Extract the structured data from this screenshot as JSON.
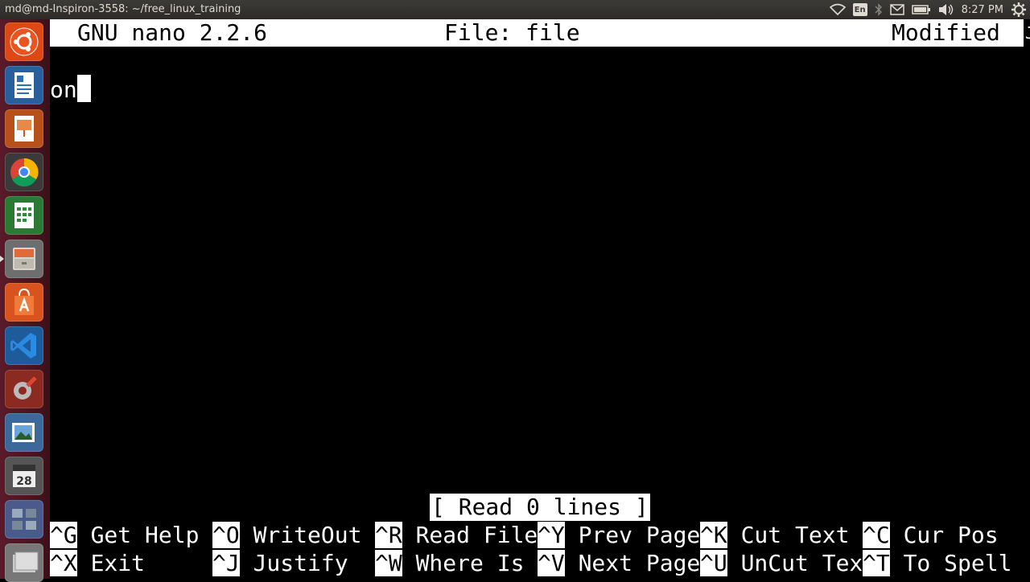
{
  "top_panel": {
    "window_title": "md@md-Inspiron-3558: ~/free_linux_training",
    "keyboard_layout": "En",
    "clock": "8:27 PM",
    "indicator_icons": [
      "wifi-icon",
      "keyboard-layout-icon",
      "bluetooth-icon",
      "mail-icon",
      "battery-icon",
      "volume-icon",
      "settings-gear-icon"
    ]
  },
  "launcher": {
    "items": [
      {
        "name": "dash-home",
        "icon": "ubuntu-logo-icon",
        "color": "#dd4814"
      },
      {
        "name": "libreoffice-writer",
        "icon": "writer-doc-icon",
        "color": "#2a6fb8"
      },
      {
        "name": "libreoffice-impress",
        "icon": "impress-presentation-icon",
        "color": "#c85a19"
      },
      {
        "name": "chrome",
        "icon": "chrome-icon",
        "color": "#4285f4"
      },
      {
        "name": "libreoffice-calc",
        "icon": "calc-spreadsheet-icon",
        "color": "#2e8b3a"
      },
      {
        "name": "files",
        "icon": "file-cabinet-icon",
        "color": "#8a8a8a"
      },
      {
        "name": "software-center",
        "icon": "shopping-bag-icon",
        "color": "#e2571e"
      },
      {
        "name": "vscode",
        "icon": "vscode-icon",
        "color": "#0078d4"
      },
      {
        "name": "system-settings",
        "icon": "settings-wrench-icon",
        "color": "#b23a2a"
      },
      {
        "name": "image-viewer",
        "icon": "photo-icon",
        "color": "#4a7fb5"
      },
      {
        "name": "calendar",
        "icon": "calendar-icon",
        "color": "#6a6a6a",
        "text": "28"
      },
      {
        "name": "workspaces",
        "icon": "workspace-switcher-icon",
        "color": "#5a6a9a"
      }
    ]
  },
  "nano": {
    "version": "GNU nano 2.2.6",
    "file_label": "File: file",
    "modified": "Modified",
    "header_edge": "J",
    "buffer_text": "on",
    "status_message": "[ Read 0 lines ]",
    "shortcuts_row1": [
      {
        "key": "^G",
        "label": " Get Help"
      },
      {
        "key": "^O",
        "label": " WriteOut"
      },
      {
        "key": "^R",
        "label": " Read File"
      },
      {
        "key": "^Y",
        "label": " Prev Page"
      },
      {
        "key": "^K",
        "label": " Cut Text"
      },
      {
        "key": "^C",
        "label": " Cur Pos"
      }
    ],
    "shortcuts_row2": [
      {
        "key": "^X",
        "label": " Exit"
      },
      {
        "key": "^J",
        "label": " Justify"
      },
      {
        "key": "^W",
        "label": " Where Is"
      },
      {
        "key": "^V",
        "label": " Next Page"
      },
      {
        "key": "^U",
        "label": " UnCut Tex"
      },
      {
        "key": "^T",
        "label": " To Spell"
      }
    ]
  }
}
